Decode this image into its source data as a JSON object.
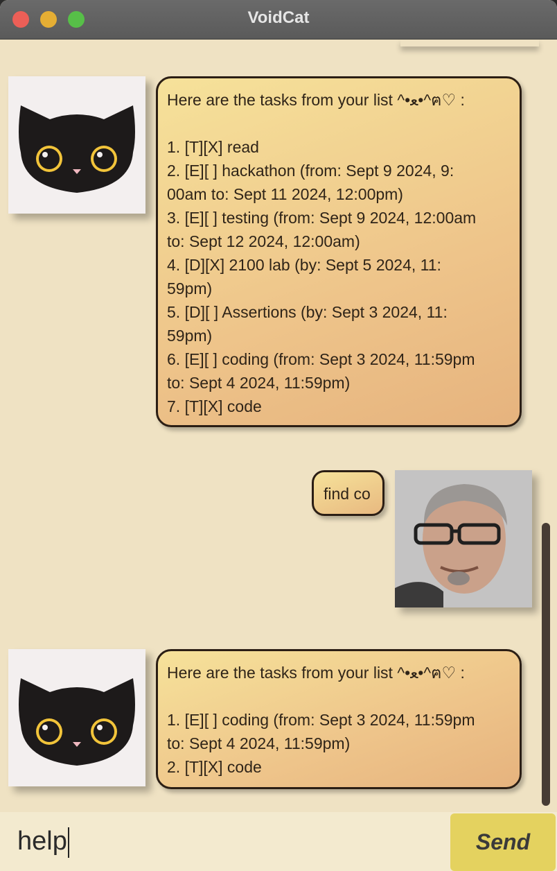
{
  "window": {
    "title": "VoidCat"
  },
  "messages": [
    {
      "sender": "bot",
      "lines": [
        "Here are the tasks from your list ^•ﻌ•^ฅ♡ :",
        "",
        "1. [T][X] read",
        "2. [E][ ] hackathon (from: Sept 9 2024, 9:",
        "00am to: Sept 11 2024, 12:00pm)",
        "3. [E][ ] testing (from: Sept 9 2024, 12:00am",
        "to: Sept 12 2024, 12:00am)",
        "4. [D][X] 2100 lab (by: Sept 5 2024, 11:",
        "59pm)",
        "5. [D][ ] Assertions (by: Sept 3 2024, 11:",
        "59pm)",
        "6. [E][ ] coding (from: Sept 3 2024, 11:59pm",
        "to: Sept 4 2024, 11:59pm)",
        "7. [T][X] code"
      ]
    },
    {
      "sender": "user",
      "text": "find co"
    },
    {
      "sender": "bot",
      "lines": [
        "Here are the tasks from your list ^•ﻌ•^ฅ♡ :",
        "",
        "1. [E][ ] coding (from: Sept 3 2024, 11:59pm",
        "to: Sept 4 2024, 11:59pm)",
        "2. [T][X] code"
      ]
    }
  ],
  "input": {
    "value": "help"
  },
  "send_button": {
    "label": "Send"
  },
  "colors": {
    "background": "#efe2c3",
    "bubble_start": "#f6e29a",
    "bubble_end": "#e6b37e",
    "send_button": "#e4d25f"
  }
}
